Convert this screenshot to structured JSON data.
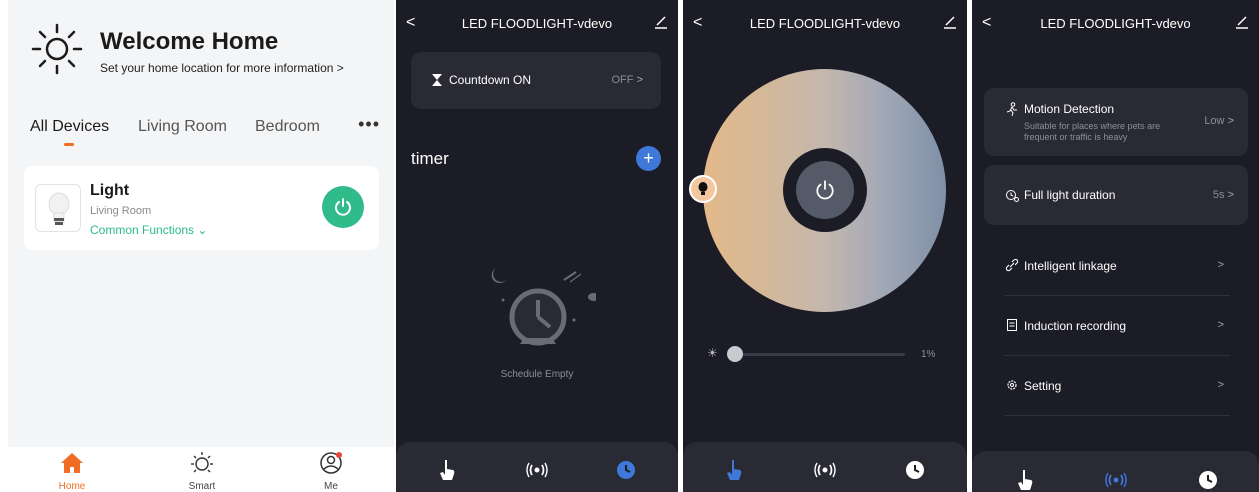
{
  "home": {
    "title": "Welcome Home",
    "subtitle": "Set your home location for more information",
    "subtitle_arrow": ">",
    "tabs": [
      "All Devices",
      "Living Room",
      "Bedroom"
    ],
    "more": "•••",
    "device": {
      "name": "Light",
      "room": "Living Room",
      "functions": "Common Functions"
    },
    "nav": [
      "Home",
      "Smart",
      "Me"
    ],
    "accent": "#f26c24",
    "power_color": "#2fbb8a"
  },
  "timer_screen": {
    "title": "LED FLOODLIGHT-vdevo",
    "countdown_label": "Countdown ON",
    "countdown_value": "OFF",
    "timer_label": "timer",
    "add_label": "+",
    "empty_label": "Schedule Empty"
  },
  "color_screen": {
    "title": "LED FLOODLIGHT-vdevo",
    "brightness": "1%"
  },
  "settings_screen": {
    "title": "LED FLOODLIGHT-vdevo",
    "motion_label": "Motion Detection",
    "motion_desc": "Suitable for places where pets are frequent or traffic is heavy",
    "motion_value": "Low",
    "duration_label": "Full light duration",
    "duration_value": "5s",
    "linkage_label": "Intelligent linkage",
    "recording_label": "Induction recording",
    "setting_label": "Setting"
  }
}
